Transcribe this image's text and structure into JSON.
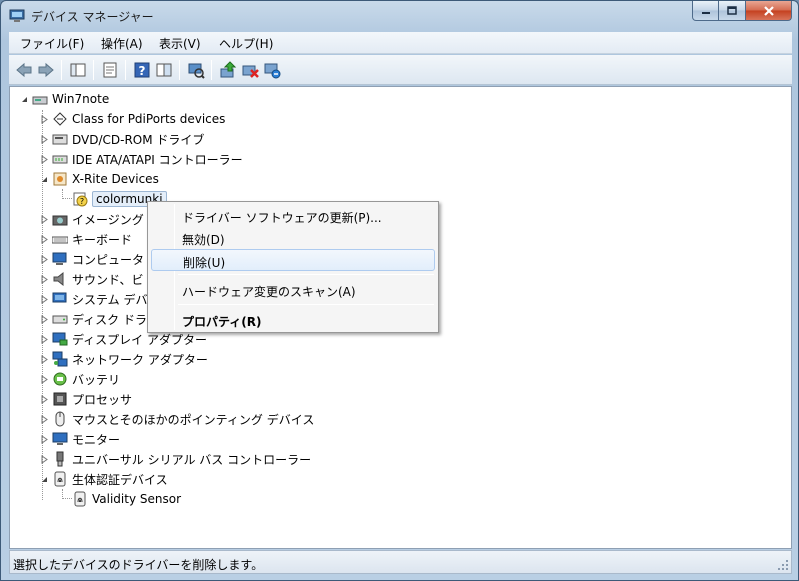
{
  "window": {
    "title": "デバイス マネージャー"
  },
  "menubar": {
    "items": [
      {
        "label": "ファイル(F)"
      },
      {
        "label": "操作(A)"
      },
      {
        "label": "表示(V)"
      },
      {
        "label": "ヘルプ(H)"
      }
    ]
  },
  "tree": {
    "root": "Win7note",
    "items": [
      {
        "label": "Class for PdiPorts devices",
        "icon": "ports-icon"
      },
      {
        "label": "DVD/CD-ROM ドライブ",
        "icon": "dvd-drive-icon"
      },
      {
        "label": "IDE ATA/ATAPI コントローラー",
        "icon": "ide-controller-icon"
      },
      {
        "label": "X-Rite Devices",
        "icon": "xrite-device-icon",
        "expanded": true
      },
      {
        "label": "colormunki",
        "icon": "unknown-device-icon",
        "child": true,
        "selected": true
      },
      {
        "label": "イメージング",
        "icon": "camera-icon"
      },
      {
        "label": "キーボード",
        "icon": "keyboard-icon"
      },
      {
        "label": "コンピュータ",
        "icon": "computer-icon"
      },
      {
        "label": "サウンド、ビ",
        "icon": "speaker-icon"
      },
      {
        "label": "システム デバ",
        "icon": "system-device-icon"
      },
      {
        "label": "ディスク ドラ",
        "icon": "disk-drive-icon"
      },
      {
        "label": "ディスプレイ アダプター",
        "icon": "display-adapter-icon"
      },
      {
        "label": "ネットワーク アダプター",
        "icon": "network-adapter-icon"
      },
      {
        "label": "バッテリ",
        "icon": "battery-icon"
      },
      {
        "label": "プロセッサ",
        "icon": "processor-icon"
      },
      {
        "label": "マウスとそのほかのポインティング デバイス",
        "icon": "mouse-icon"
      },
      {
        "label": "モニター",
        "icon": "monitor-icon"
      },
      {
        "label": "ユニバーサル シリアル バス コントローラー",
        "icon": "usb-icon"
      },
      {
        "label": "生体認証デバイス",
        "icon": "fingerprint-icon",
        "expanded": true
      },
      {
        "label": "Validity Sensor",
        "icon": "fingerprint-sensor-icon",
        "child": true
      }
    ]
  },
  "context_menu": {
    "items": [
      {
        "label": "ドライバー ソフトウェアの更新(P)..."
      },
      {
        "label": "無効(D)"
      },
      {
        "label": "削除(U)",
        "hover": true
      },
      {
        "label": "ハードウェア変更のスキャン(A)"
      },
      {
        "label": "プロパティ(R)",
        "bold": true
      }
    ]
  },
  "status": {
    "text": "選択したデバイスのドライバーを削除します。"
  },
  "colors": {
    "accent": "#3399ff",
    "selection": "#e4eef9",
    "close_button": "#c4401f"
  }
}
